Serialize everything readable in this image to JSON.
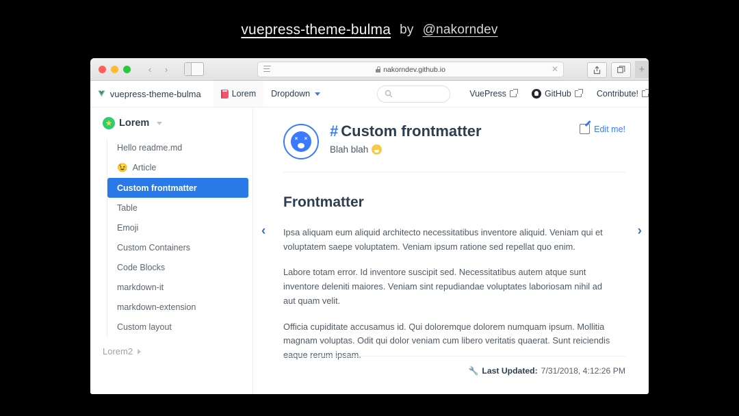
{
  "banner": {
    "repo": "vuepress-theme-bulma",
    "by": "by",
    "author": "@nakorndev"
  },
  "browser": {
    "url": "nakorndev.github.io",
    "lock_icon": "lock-icon",
    "back_icon": "‹",
    "forward_icon": "›",
    "close_icon": "✕",
    "share_icon": "⇧",
    "tabs_icon": "⧉",
    "new_tab_icon": "+"
  },
  "navbar": {
    "brand": "vuepress-theme-bulma",
    "items": [
      {
        "label": "Lorem",
        "icon": "book-icon"
      },
      {
        "label": "Dropdown",
        "icon": "chevron-down-icon"
      }
    ],
    "search_placeholder": "",
    "search_icon": "search-icon",
    "links": [
      {
        "label": "VuePress",
        "icon": "external-link-icon"
      },
      {
        "label": "GitHub",
        "icon": "github-icon"
      },
      {
        "label": "Contribute!",
        "icon": "external-link-icon"
      }
    ]
  },
  "sidebar": {
    "group_title": "Lorem",
    "group_icon": "star-icon",
    "items": [
      {
        "label": "Hello readme.md",
        "active": false
      },
      {
        "label": "Article",
        "active": false,
        "emoji": "😉"
      },
      {
        "label": "Custom frontmatter",
        "active": true
      },
      {
        "label": "Table",
        "active": false
      },
      {
        "label": "Emoji",
        "active": false
      },
      {
        "label": "Custom Containers",
        "active": false
      },
      {
        "label": "Code Blocks",
        "active": false
      },
      {
        "label": "markdown-it",
        "active": false
      },
      {
        "label": "markdown-extension",
        "active": false
      },
      {
        "label": "Custom layout",
        "active": false
      }
    ],
    "collapsed_group": "Lorem2"
  },
  "page": {
    "hash": "#",
    "title": "Custom frontmatter",
    "subtitle": "Blah blah",
    "edit_label": "Edit me!",
    "heading": "Frontmatter",
    "paragraphs": [
      "Ipsa aliquam eum aliquid architecto necessitatibus inventore aliquid. Veniam qui et voluptatem saepe voluptatem. Veniam ipsum ratione sed repellat quo enim.",
      "Labore totam error. Id inventore suscipit sed. Necessitatibus autem atque sunt inventore deleniti maiores. Veniam sint repudiandae voluptates laboriosam nihil ad aut quam velit.",
      "Officia cupiditate accusamus id. Qui doloremque dolorem numquam ipsum. Mollitia magnam voluptas. Odit qui dolor veniam cum libero veritatis quaerat. Sunt reiciendis eaque rerum ipsam."
    ],
    "prev_arrow": "‹",
    "next_arrow": "›",
    "footer_label": "Last Updated:",
    "footer_value": "7/31/2018, 4:12:26 PM",
    "footer_icon": "🔧"
  },
  "colors": {
    "accent": "#3a7afe",
    "active_item": "#2979e8",
    "background": "#000000"
  }
}
